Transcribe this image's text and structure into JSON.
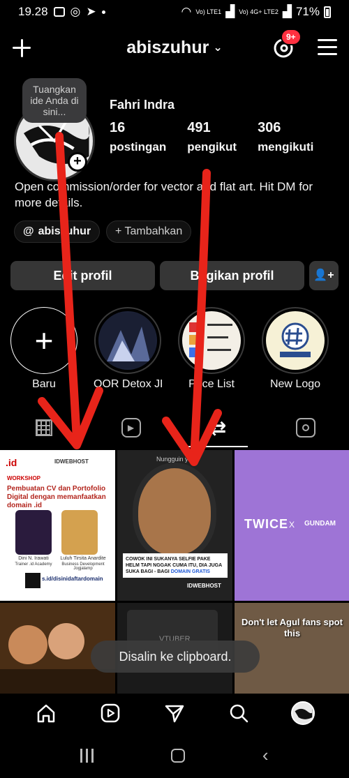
{
  "status": {
    "time": "19.28",
    "battery": "71%",
    "sig1": "Vo) LTE1",
    "sig2": "Vo) 4G+ LTE2"
  },
  "header": {
    "username": "abiszuhur",
    "chevron": "⌄",
    "badge": "9+"
  },
  "profile": {
    "note": "Tuangkan ide Anda di sini...",
    "name": "Fahri Indra",
    "stats": [
      {
        "num": "16",
        "label": "postingan"
      },
      {
        "num": "491",
        "label": "pengikut"
      },
      {
        "num": "306",
        "label": "mengikuti"
      }
    ],
    "bio": "Open commission/order for vector and flat art. Hit DM for more details.",
    "handle_chip": "abiszuhur",
    "add_chip": "+ Tambahkan"
  },
  "buttons": {
    "edit": "Edit profil",
    "share": "Bagikan profil"
  },
  "highlights": [
    {
      "label": "Baru"
    },
    {
      "label": "OOR Detox JK..."
    },
    {
      "label": "Price List"
    },
    {
      "label": "New Logo"
    }
  ],
  "posts": {
    "p1": {
      "brand": ".id",
      "brand2": "IDWEBHOST",
      "workshop": "WORKSHOP",
      "title": "Pembuatan CV dan Portofolio Digital dengan memanfaatkan domain .id",
      "person1": "Dini N. Irawati",
      "person1_role": "Trainer .id Academy",
      "person2": "Luluh Tirsita Anardite",
      "person2_role": "Business Development Jogjalamp",
      "link": "s.id/disinidaftardomain"
    },
    "p2": {
      "cap": "COWOK INI SUKANYA SELFIE PAKE HELM TAPI NGGAK CUMA ITU, DIA JUGA SUKA BAGI - BAGI",
      "cap_highlight": "DOMAIN GRATIS",
      "brand": "IDWEBHOST",
      "helmet": "Nungguin ya?"
    },
    "p3": {
      "left": "TWICE",
      "x": "X",
      "right": "GUNDAM"
    },
    "p5": {
      "text": "VTUBER"
    },
    "p6": {
      "text": "Don't let Agul fans spot this"
    }
  },
  "toast": "Disalin ke clipboard.",
  "colors": {
    "accent": "#ff3040",
    "background": "#000000",
    "button": "#363636"
  }
}
